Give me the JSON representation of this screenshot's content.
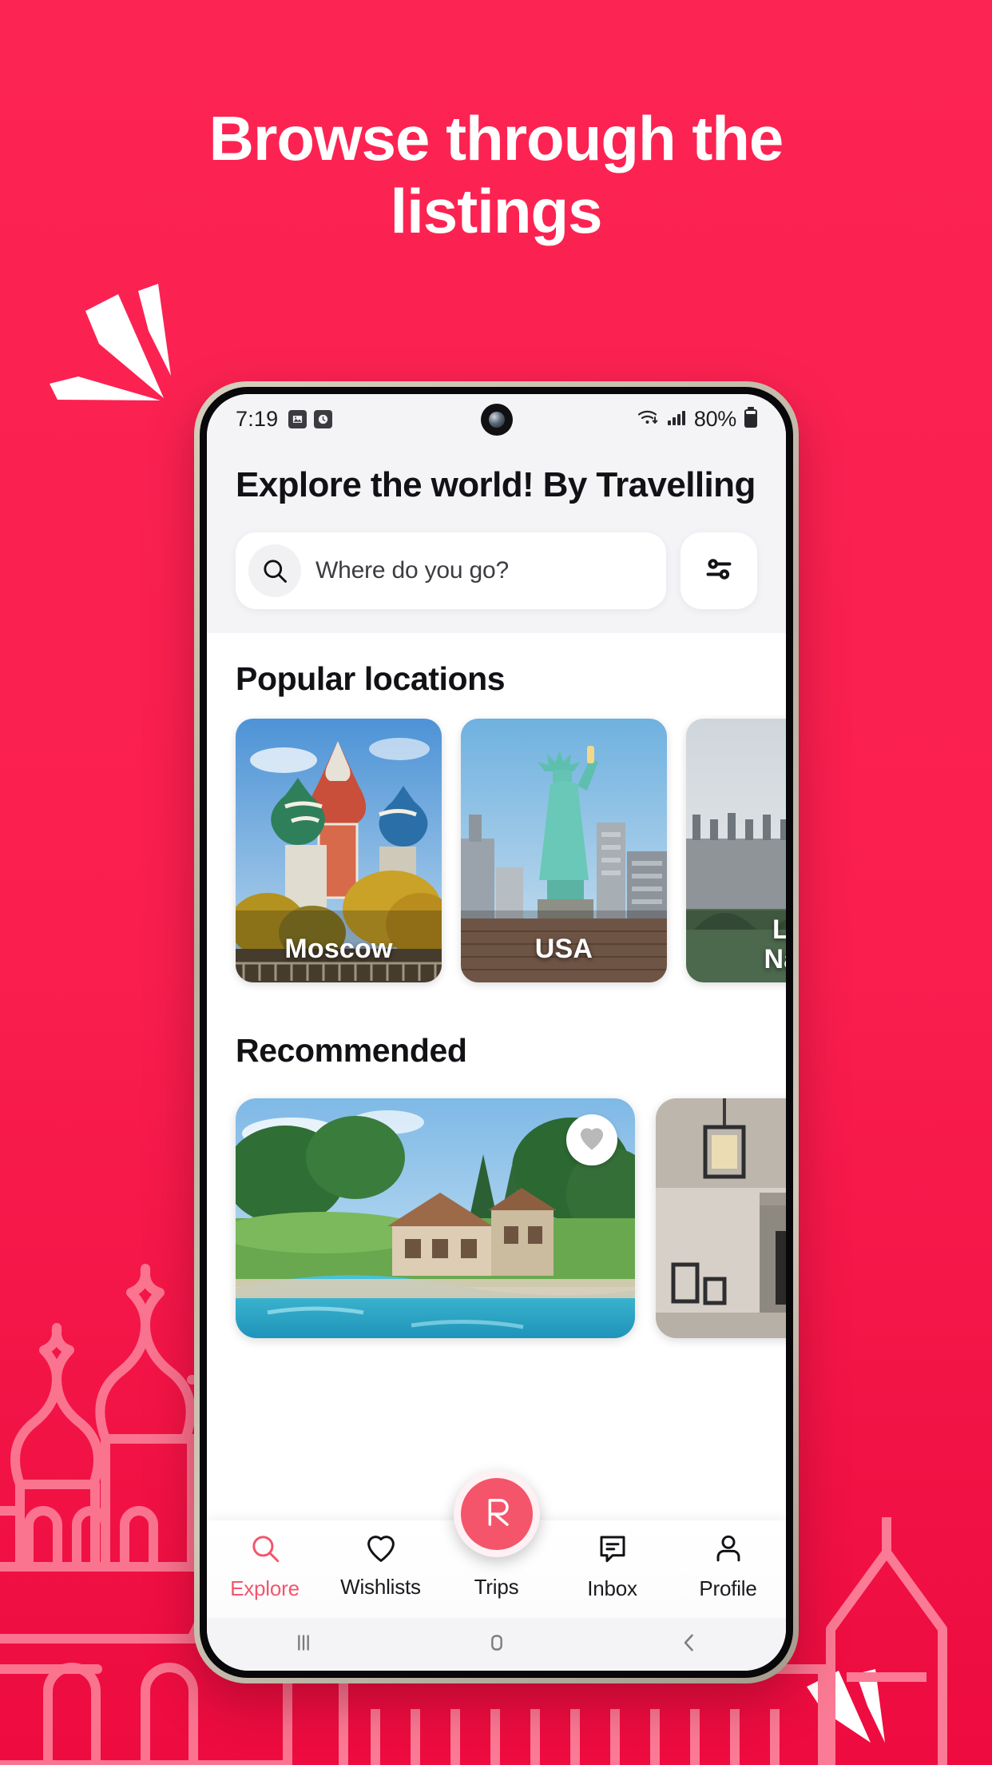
{
  "promo": {
    "headline_line1": "Browse through the",
    "headline_line2": "listings",
    "background_color": "#FA2252",
    "accent_color": "#F2566D"
  },
  "statusbar": {
    "time": "7:19",
    "left_icons": [
      "image-icon",
      "clock-icon"
    ],
    "wifi_icon": "wifi-icon",
    "signal_icon": "cellular-signal-icon",
    "battery_text": "80%",
    "battery_icon": "battery-icon"
  },
  "app_header": {
    "title": "Explore the world! By Travelling",
    "search": {
      "placeholder": "Where do you go?",
      "icon": "search-icon"
    },
    "filter_button": {
      "icon": "tune-sliders-icon",
      "label": "Filters"
    }
  },
  "sections": {
    "popular": {
      "title": "Popular locations",
      "cards": [
        {
          "name": "Moscow",
          "art": "saint-basils-cathedral"
        },
        {
          "name": "USA",
          "art": "statue-of-liberty"
        },
        {
          "name": "London Navy",
          "name_line1": "Lo",
          "name_line2": "Nav",
          "art": "westminster-bridge"
        }
      ]
    },
    "recommended": {
      "title": "Recommended",
      "cards": [
        {
          "art": "villa-with-pool",
          "favorite_icon": "heart-icon",
          "favorited": false
        },
        {
          "art": "modern-interior-fireplace"
        }
      ]
    }
  },
  "bottom_nav": {
    "items": [
      {
        "label": "Explore",
        "icon": "search-icon",
        "active": true
      },
      {
        "label": "Wishlists",
        "icon": "heart-icon",
        "active": false
      },
      {
        "label": "Trips",
        "icon": "fab-logo-r",
        "active": false
      },
      {
        "label": "Inbox",
        "icon": "message-icon",
        "active": false
      },
      {
        "label": "Profile",
        "icon": "person-icon",
        "active": false
      }
    ],
    "fab": {
      "icon": "brand-r-logo",
      "color": "#F4556B"
    }
  },
  "android_nav": {
    "recents_icon": "recents-bars-icon",
    "home_icon": "home-square-icon",
    "back_icon": "back-chevron-icon"
  }
}
